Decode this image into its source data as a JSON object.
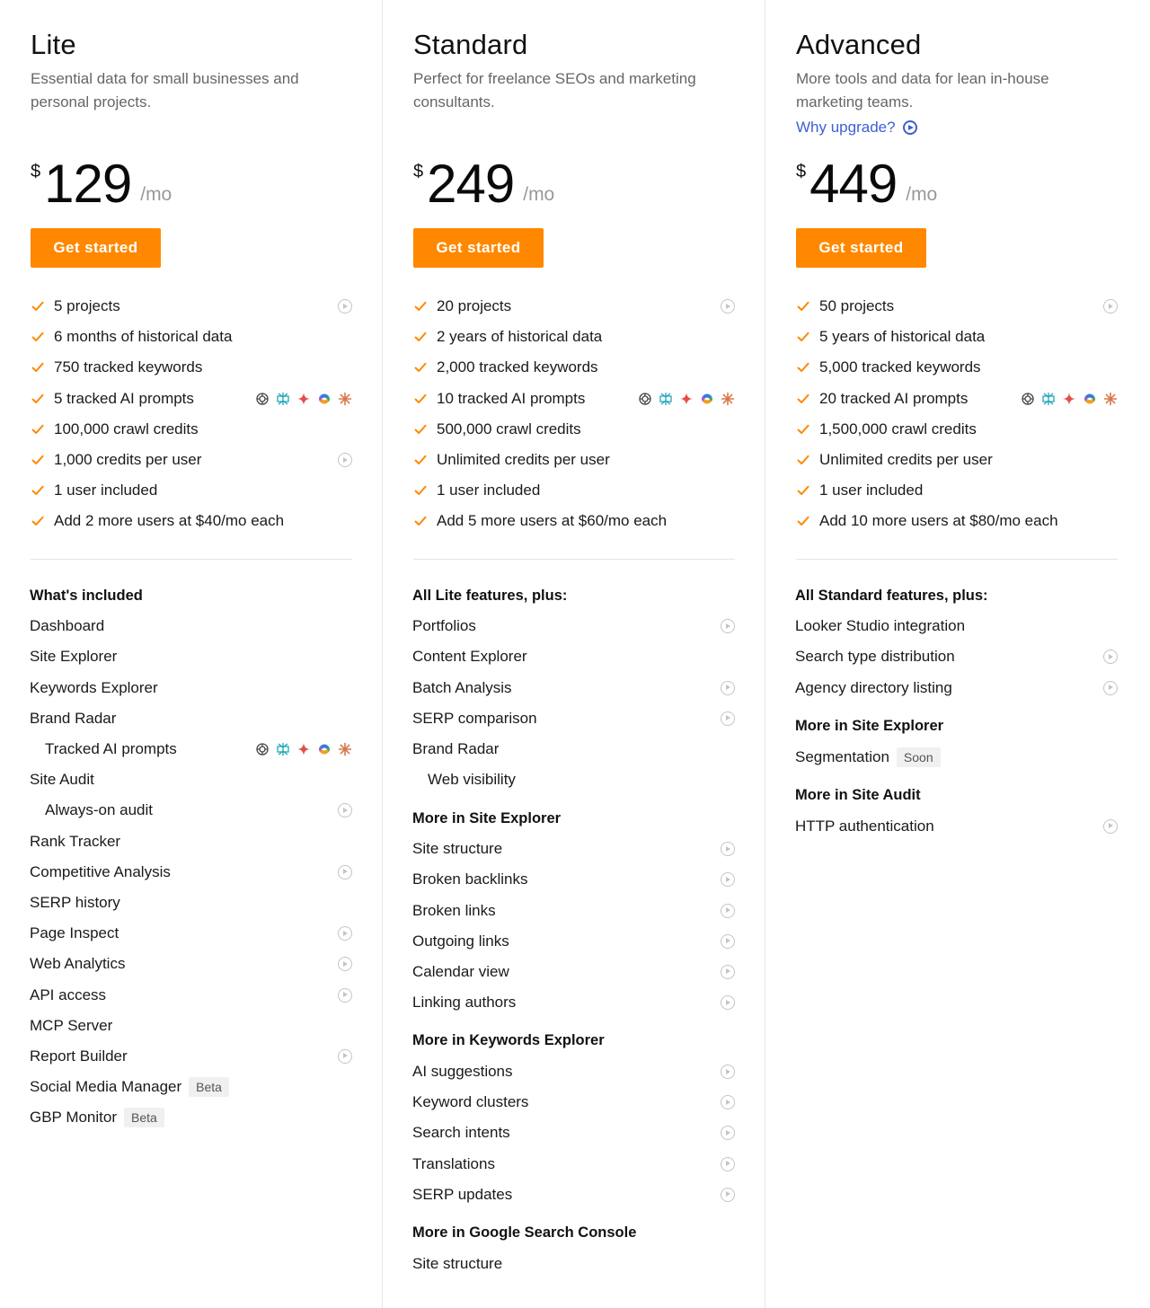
{
  "colors": {
    "accent": "#ff8800",
    "link": "#3b5fd6",
    "check": "#ff8800"
  },
  "ai_icons": [
    "chatgpt-icon",
    "perplexity-icon",
    "gemini-icon",
    "copilot-icon",
    "claude-icon"
  ],
  "plans": [
    {
      "name": "Lite",
      "description": "Essential data for small businesses and personal projects.",
      "currency": "$",
      "amount": "129",
      "period": "/mo",
      "cta": "Get started",
      "limits": [
        "5 projects",
        "6 months of historical data",
        "750 tracked keywords",
        "5 tracked AI prompts",
        "100,000 crawl credits",
        "1,000 credits per user",
        "1 user included",
        "Add 2 more users at $40/mo each"
      ],
      "features_heading": "What's included",
      "features": [
        "Dashboard",
        "Site Explorer",
        "Keywords Explorer",
        "Brand Radar",
        "Tracked AI prompts",
        "Site Audit",
        "Always-on audit",
        "Rank Tracker",
        "Competitive Analysis",
        "SERP history",
        "Page Inspect",
        "Web Analytics",
        "API access",
        "MCP Server",
        "Report Builder",
        "Social Media Manager",
        "GBP Monitor"
      ],
      "badges": {
        "beta": "Beta"
      }
    },
    {
      "name": "Standard",
      "description": "Perfect for freelance SEOs and marketing consultants.",
      "currency": "$",
      "amount": "249",
      "period": "/mo",
      "cta": "Get started",
      "limits": [
        "20 projects",
        "2 years of historical data",
        "2,000 tracked keywords",
        "10 tracked AI prompts",
        "500,000 crawl credits",
        "Unlimited credits per user",
        "1 user included",
        "Add 5 more users at $60/mo each"
      ],
      "features_heading": "All Lite features, plus:",
      "features": [
        "Portfolios",
        "Content Explorer",
        "Batch Analysis",
        "SERP comparison",
        "Brand Radar",
        "Web visibility"
      ],
      "groups": [
        {
          "heading": "More in Site Explorer",
          "items": [
            "Site structure",
            "Broken backlinks",
            "Broken links",
            "Outgoing links",
            "Calendar view",
            "Linking authors"
          ]
        },
        {
          "heading": "More in Keywords Explorer",
          "items": [
            "AI suggestions",
            "Keyword clusters",
            "Search intents",
            "Translations",
            "SERP updates"
          ]
        },
        {
          "heading": "More in Google Search Console",
          "items": [
            "Site structure"
          ]
        }
      ]
    },
    {
      "name": "Advanced",
      "description": "More tools and data for lean in-house marketing teams.",
      "upgrade_link": "Why upgrade?",
      "currency": "$",
      "amount": "449",
      "period": "/mo",
      "cta": "Get started",
      "limits": [
        "50 projects",
        "5 years of historical data",
        "5,000 tracked keywords",
        "20 tracked AI prompts",
        "1,500,000 crawl credits",
        "Unlimited credits per user",
        "1 user included",
        "Add 10 more users at $80/mo each"
      ],
      "features_heading": "All Standard features, plus:",
      "features": [
        "Looker Studio integration",
        "Search type distribution",
        "Agency directory listing"
      ],
      "groups": [
        {
          "heading": "More in Site Explorer",
          "items": [
            "Segmentation"
          ]
        },
        {
          "heading": "More in Site Audit",
          "items": [
            "HTTP authentication"
          ]
        }
      ],
      "badges": {
        "soon": "Soon"
      }
    }
  ]
}
